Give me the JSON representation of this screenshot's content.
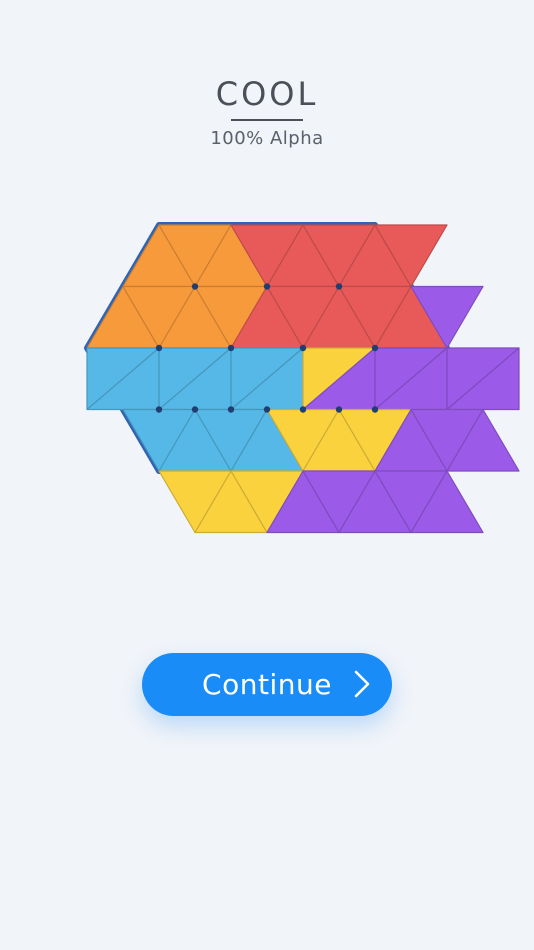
{
  "header": {
    "title": "COOL",
    "subtitle": "100% Alpha"
  },
  "board": {
    "rows": [
      [
        "orange",
        "orange",
        "orange",
        "red",
        "red",
        "red",
        "red",
        "red"
      ],
      [
        "orange",
        "orange",
        "orange",
        "orange",
        "red",
        "red",
        "red",
        "red",
        "red",
        "purple"
      ],
      [
        "blue",
        "blue",
        "blue",
        "blue",
        "blue",
        "blue",
        "yellow",
        "purple",
        "purple",
        "purple",
        "purple",
        "purple"
      ],
      [
        "blue",
        "blue",
        "blue",
        "blue",
        "yellow",
        "yellow",
        "yellow",
        "purple",
        "purple",
        "purple"
      ],
      [
        "yellow",
        "yellow",
        "yellow",
        "purple",
        "purple",
        "purple",
        "purple",
        "purple"
      ]
    ],
    "colors": {
      "orange": "#f79a3c",
      "red": "#e85a5a",
      "purple": "#9b5be8",
      "blue": "#56b8e6",
      "yellow": "#fad23e"
    },
    "frame_color": "#2f63b4"
  },
  "continue_button": {
    "label": "Continue",
    "icon": "chevron-right-icon",
    "color": "#1a8cf7"
  }
}
